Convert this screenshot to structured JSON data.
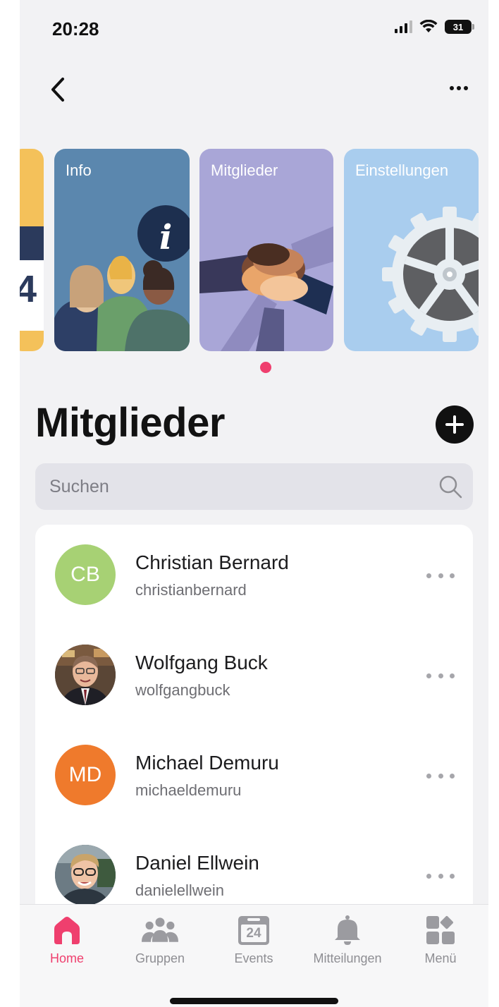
{
  "status": {
    "time": "20:28",
    "battery": "31"
  },
  "carousel": {
    "partial_digit": "4",
    "cards": [
      {
        "title": "Info",
        "icon": "info-icon"
      },
      {
        "title": "Mitglieder",
        "icon": "hands-together-illustration"
      },
      {
        "title": "Einstellungen",
        "icon": "gear-icon"
      }
    ]
  },
  "page": {
    "title": "Mitglieder"
  },
  "search": {
    "placeholder": "Suchen"
  },
  "members": [
    {
      "name": "Christian Bernard",
      "username": "christianbernard",
      "initials": "CB",
      "avatar_color": "#a7d174"
    },
    {
      "name": "Wolfgang Buck",
      "username": "wolfgangbuck",
      "initials": "",
      "avatar_color": "#3a2f2a"
    },
    {
      "name": "Michael Demuru",
      "username": "michaeldemuru",
      "initials": "MD",
      "avatar_color": "#ef7a2c"
    },
    {
      "name": "Daniel Ellwein",
      "username": "danielellwein",
      "initials": "",
      "avatar_color": "#4a5a63"
    }
  ],
  "tabs": [
    {
      "label": "Home",
      "icon": "home-icon",
      "active": true
    },
    {
      "label": "Gruppen",
      "icon": "groups-icon",
      "active": false
    },
    {
      "label": "Events",
      "icon": "calendar-icon",
      "date": "24",
      "active": false
    },
    {
      "label": "Mitteilungen",
      "icon": "bell-icon",
      "active": false
    },
    {
      "label": "Menü",
      "icon": "menu-grid-icon",
      "active": false
    }
  ],
  "colors": {
    "accent": "#ef3f6e",
    "background": "#f2f2f4"
  }
}
